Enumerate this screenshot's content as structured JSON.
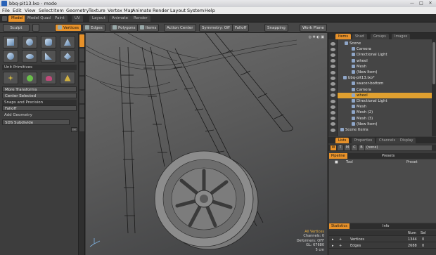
{
  "window": {
    "title": "bbq-pit13.lxo - modo",
    "min": "—",
    "max": "□",
    "close": "✕"
  },
  "menu": [
    "File",
    "Edit",
    "View",
    "Select",
    "Item",
    "Geometry",
    "Texture",
    "Vertex Map",
    "Animate",
    "Render",
    "Layout",
    "System",
    "Help"
  ],
  "layout_tabs": [
    "Model",
    "Model Quad",
    "Paint",
    "UV",
    "Layout",
    "Animate",
    "Render"
  ],
  "toolbar": {
    "sculpt": "Sculpt",
    "vertices": "Vertices",
    "edges": "Edges",
    "polygons": "Polygons",
    "items": "Items",
    "action_center": "Action Center",
    "symmetry": "Symmetry: Off",
    "falloff": "Falloff",
    "snapping": "Snapping",
    "work_plane": "Work Plane"
  },
  "left_panel": {
    "unit_primitives": "Unit Primitives",
    "more_transforms": "More Transforms",
    "center_selected": "Center Selected",
    "snaps_header": "Snaps and Precision",
    "falloff": "Falloff",
    "add_geometry": "Add Geometry",
    "sds_subdivide": "SDS Subdivide",
    "more": "..."
  },
  "items_panel": {
    "tabs": [
      "Items",
      "Shad",
      "Groups",
      "Images"
    ],
    "rows": [
      {
        "label": "Scene",
        "selected": false
      },
      {
        "label": "Camera",
        "selected": false
      },
      {
        "label": "Directional Light",
        "selected": false
      },
      {
        "label": "wheel",
        "selected": false
      },
      {
        "label": "Mesh",
        "selected": false
      },
      {
        "label": "(New Item)",
        "selected": false
      },
      {
        "label": "bbq-pit13.lxo*",
        "selected": false
      },
      {
        "label": "saucer-bottom",
        "selected": false
      },
      {
        "label": "Camera",
        "selected": false
      },
      {
        "label": "wheel",
        "selected": true
      },
      {
        "label": "Directional Light",
        "selected": false
      },
      {
        "label": "Mesh",
        "selected": false
      },
      {
        "label": "Mesh (2)",
        "selected": false
      },
      {
        "label": "Mesh (3)",
        "selected": false
      },
      {
        "label": "(New Item)",
        "selected": false
      },
      {
        "label": "Scene Items",
        "selected": false
      }
    ]
  },
  "props_panel": {
    "tabs": [
      "Lists",
      "Properties",
      "Channels",
      "Display"
    ],
    "none": "(none)",
    "pipeline": "Pipeline",
    "presets": "Presets",
    "col_tool": "Tool",
    "col_preset": "Preset"
  },
  "stats_panel": {
    "statistics": "Statistics",
    "info": "Info",
    "col_num": "Num",
    "col_sel": "Sel",
    "rows": [
      {
        "label": "Vertices",
        "num": "1344",
        "sel": "0"
      },
      {
        "label": "Edges",
        "num": "2688",
        "sel": "0"
      }
    ]
  },
  "viewport": {
    "mode": "All Vertices",
    "channels": "Channels: 0",
    "deformers": "Deformers: OFF",
    "gl": "GL: 67680",
    "scale": "5 cm"
  }
}
